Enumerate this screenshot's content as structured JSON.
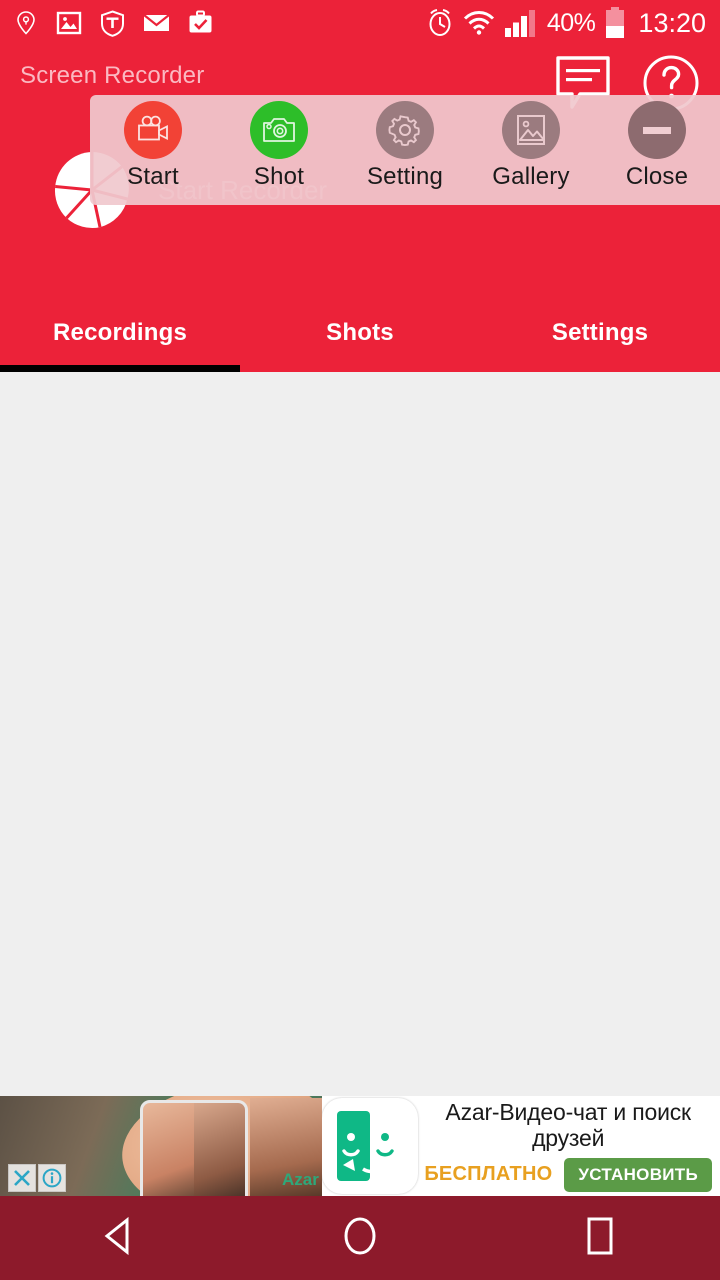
{
  "status_bar": {
    "left_icons": [
      {
        "name": "location-key-icon",
        "label": "location"
      },
      {
        "name": "gallery-image-icon",
        "label": "image"
      },
      {
        "name": "shield-t-icon",
        "label": "shield"
      },
      {
        "name": "email-icon",
        "label": "mail"
      },
      {
        "name": "briefcase-check-icon",
        "label": "work"
      }
    ],
    "alarm_icon": "alarm-clock-icon",
    "wifi_icon": "wifi-icon",
    "signal_icon": "signal-bars-icon",
    "battery_percent": "40%",
    "battery_level": 40,
    "clock": "13:20"
  },
  "header": {
    "app_title": "Screen Recorder",
    "start_recorder_label": "Start Recorder",
    "logo_icon": "camera-shutter-logo",
    "feedback_icon": "feedback-bubble-icon",
    "help_icon": "help-question-icon",
    "accent_color": "#EC2239"
  },
  "tabs": [
    {
      "label": "Recordings",
      "active": true
    },
    {
      "label": "Shots",
      "active": false
    },
    {
      "label": "Settings",
      "active": false
    }
  ],
  "overlay": {
    "panel_color": "#F0C8CE",
    "items": [
      {
        "label": "Start",
        "icon": "video-camera-icon",
        "circle_color": "#F24236"
      },
      {
        "label": "Shot",
        "icon": "photo-camera-icon",
        "circle_color": "#2DBE29"
      },
      {
        "label": "Setting",
        "icon": "gear-icon",
        "circle_color": "#9B7B7F"
      },
      {
        "label": "Gallery",
        "icon": "gallery-image-icon",
        "circle_color": "#9B7B7F"
      },
      {
        "label": "Close",
        "icon": "minus-circle-icon",
        "circle_color": "#8D6B6F"
      }
    ]
  },
  "ad": {
    "title": "Azar-Видео-чат и поиск друзей",
    "free_label": "БЕСПЛАТНО",
    "install_label": "УСТАНОВИТЬ",
    "brand_word": "Azar",
    "close_icon": "ad-close-icon",
    "info_icon": "ad-info-icon",
    "logo_icon": "azar-smiley-logo",
    "install_color": "#5B9B47",
    "free_color": "#E8A020"
  },
  "nav_bar": {
    "back_icon": "nav-back-icon",
    "home_icon": "nav-home-icon",
    "recents_icon": "nav-recents-icon",
    "bar_color": "#8D1A2B"
  }
}
